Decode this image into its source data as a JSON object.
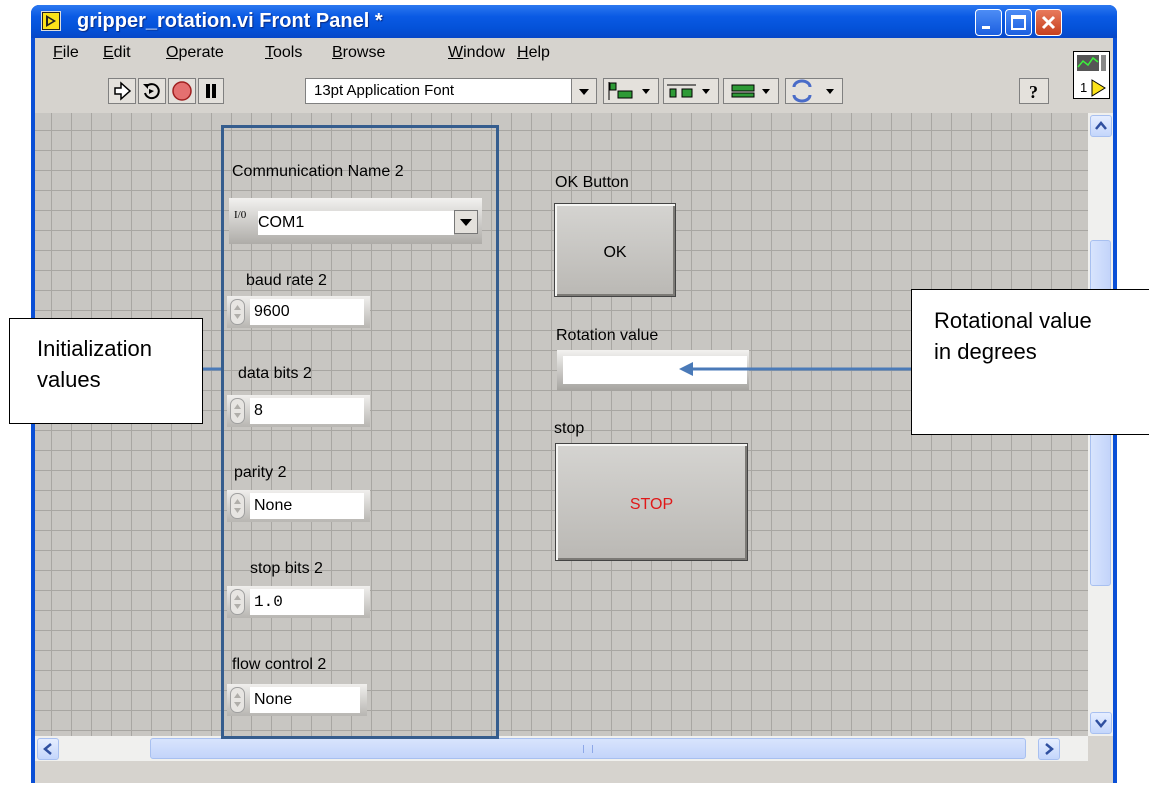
{
  "window": {
    "title": "gripper_rotation.vi Front Panel *"
  },
  "menu": [
    {
      "u": "F",
      "rest": "ile"
    },
    {
      "u": "E",
      "rest": "dit"
    },
    {
      "u": "O",
      "rest": "perate"
    },
    {
      "u": "T",
      "rest": "ools"
    },
    {
      "u": "B",
      "rest": "rowse"
    },
    {
      "u": "W",
      "rest": "indow"
    },
    {
      "u": "H",
      "rest": "elp"
    }
  ],
  "toolbar": {
    "font": "13pt Application Font",
    "vi_connector_number": "1"
  },
  "controls": {
    "communication_name": {
      "label": "Communication Name 2",
      "value": "COM1",
      "io_glyph": "I/0"
    },
    "baud_rate": {
      "label": "baud rate 2",
      "value": "9600"
    },
    "data_bits": {
      "label": "data bits 2",
      "value": "8"
    },
    "parity": {
      "label": "parity 2",
      "value": "None"
    },
    "stop_bits": {
      "label": "stop bits 2",
      "value": "1.0"
    },
    "flow_control": {
      "label": "flow control 2",
      "value": "None"
    },
    "ok_button": {
      "label": "OK Button",
      "text": "OK"
    },
    "rotation": {
      "label": "Rotation value",
      "value": ""
    },
    "stop": {
      "label": "stop",
      "text": "STOP",
      "text_color": "#e01818"
    }
  },
  "annotations": {
    "init_line1": "Initialization",
    "init_line2": "values",
    "rot_line1": "Rotational value",
    "rot_line2": "in degrees"
  },
  "colors": {
    "group_border": "#355d8e",
    "arrow": "#4a7ab8",
    "titlebar": "#0a5ae4"
  }
}
